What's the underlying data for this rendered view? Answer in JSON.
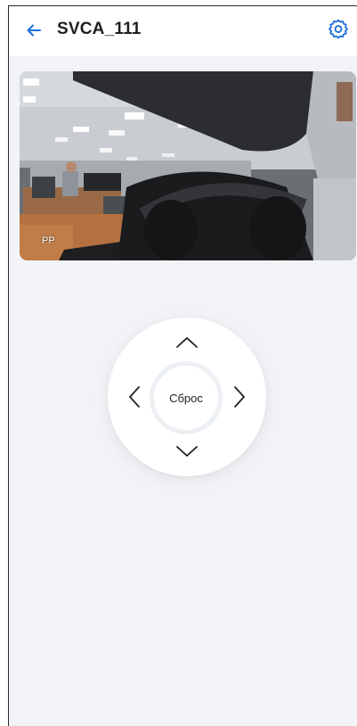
{
  "header": {
    "title": "SVCA_111",
    "back_icon": "arrow-left-icon",
    "settings_icon": "gear-icon"
  },
  "video": {
    "overlay_label": "PP"
  },
  "ptz": {
    "reset_label": "Сброс",
    "up_icon": "chevron-up-icon",
    "down_icon": "chevron-down-icon",
    "left_icon": "chevron-left-icon",
    "right_icon": "chevron-right-icon"
  },
  "colors": {
    "accent": "#1e6fd9",
    "background": "#f2f3f7",
    "header": "#ffffff"
  }
}
